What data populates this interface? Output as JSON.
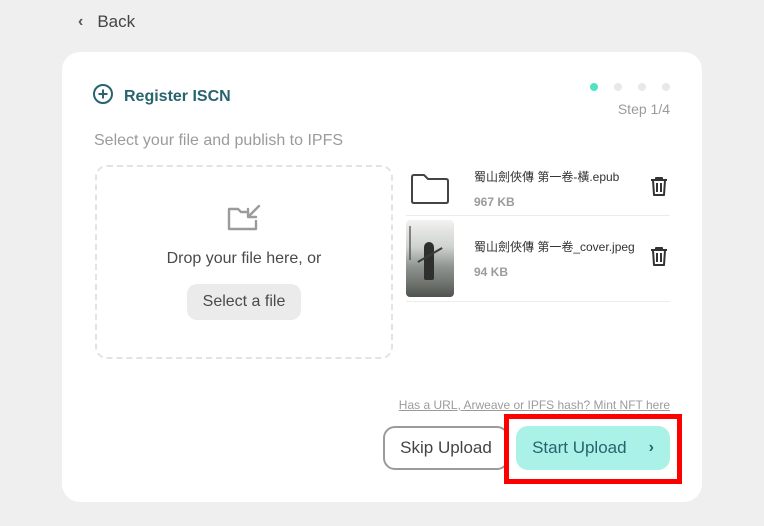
{
  "nav": {
    "back_label": "Back"
  },
  "header": {
    "title": "Register ISCN",
    "step_label": "Step 1/4",
    "steps_total": 4,
    "current_step": 1
  },
  "instruction": "Select your file and publish to IPFS",
  "dropzone": {
    "text": "Drop your file here, or",
    "button_label": "Select a file"
  },
  "files": [
    {
      "name": "蜀山劍俠傳 第一卷-橫.epub",
      "size": "967 KB",
      "thumb": "folder-icon"
    },
    {
      "name": "蜀山劍俠傳 第一卷_cover.jpeg",
      "size": "94 KB",
      "thumb": "image"
    }
  ],
  "links": {
    "url_mint": "Has a URL, Arweave or IPFS hash? Mint NFT here"
  },
  "buttons": {
    "skip_label": "Skip Upload",
    "start_label": "Start Upload",
    "start_arrow": "›"
  },
  "colors": {
    "accent": "#28646e",
    "accent_light": "#aaf1e7",
    "step_active": "#50e3c2",
    "highlight": "#ff0000"
  }
}
